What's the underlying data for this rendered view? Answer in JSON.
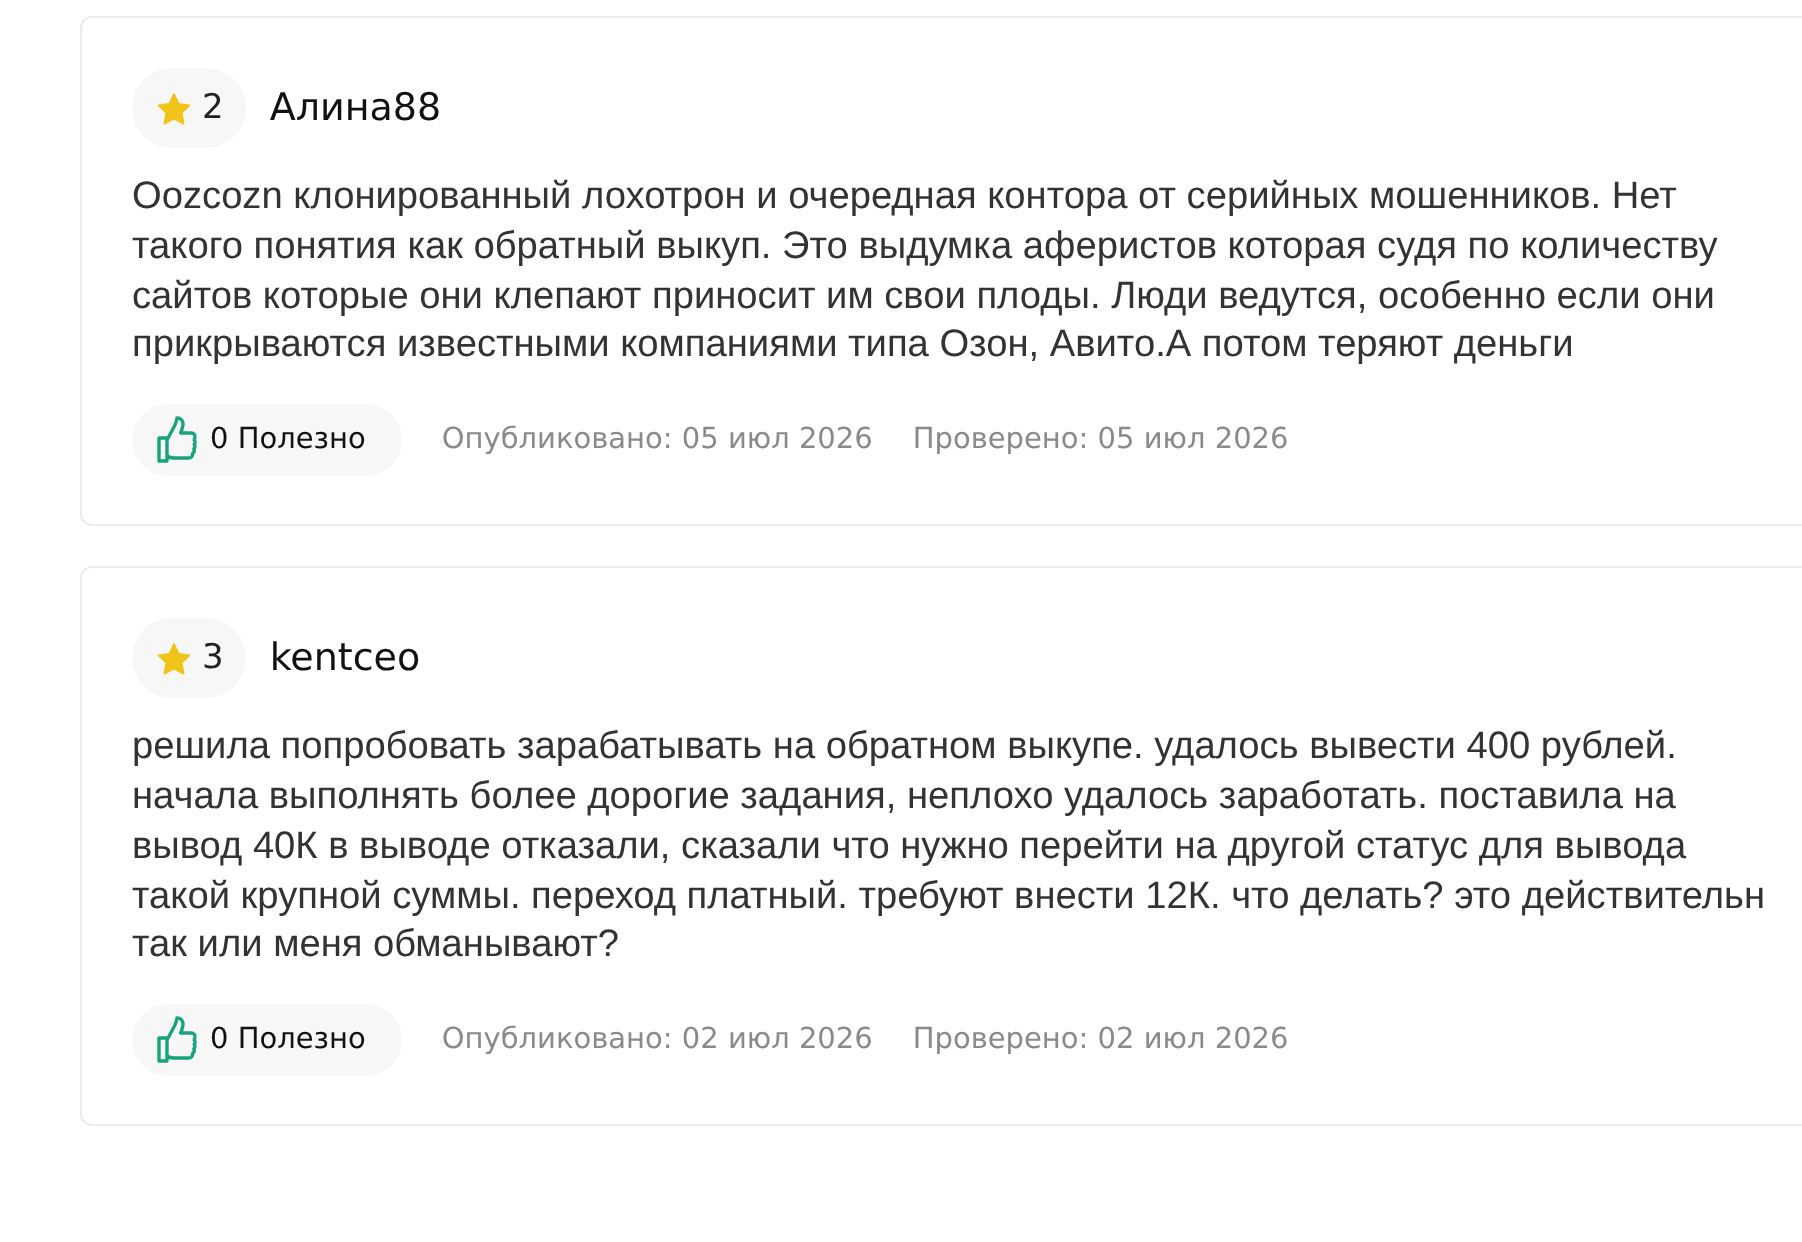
{
  "reviews": [
    {
      "rating": "2",
      "author": "Алина88",
      "text": "Oozcozn клонированный лохотрон и очередная контора от серийных мошенников. Нет такого понятия как обратный выкуп. Это выдумка аферистов которая судя по количеству сайтов которые они клепают приносит им свои плоды. Люди ведутся, особенно если они прикрываются известными компаниями типа Озон, Авито.А потом теряют деньги",
      "helpful": "0 Полезно",
      "published": "Опубликовано: 05 июл 2026",
      "verified": "Проверено: 05 июл 2026"
    },
    {
      "rating": "3",
      "author": "kentceo",
      "text": "решила попробовать зарабатывать на обратном выкупе. удалось вывести 400 рублей. начала выполнять более дорогие задания, неплохо удалось заработать. поставила на вывод 40К в выводе отказали, сказали что нужно перейти на другой статус для вывода такой крупной суммы. переход платный. требуют внести 12К. что делать? это действительн так или меня обманывают?",
      "helpful": "0 Полезно",
      "published": "Опубликовано: 02 июл 2026",
      "verified": "Проверено: 02 июл 2026"
    }
  ]
}
